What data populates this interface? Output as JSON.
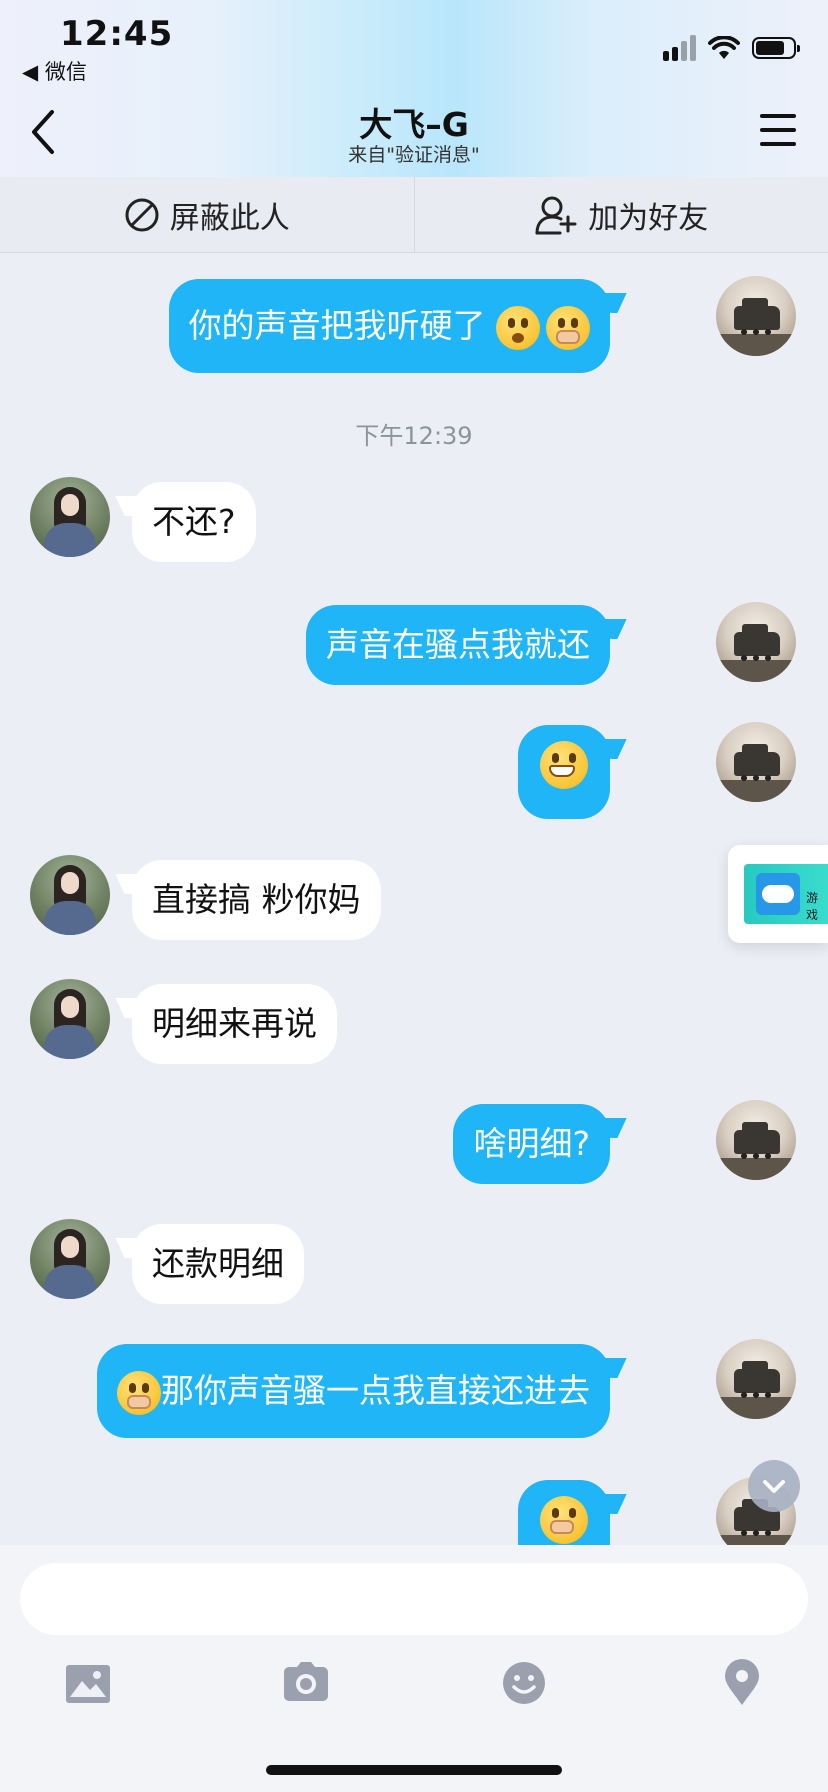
{
  "status_bar": {
    "time": "12:45",
    "back_app": "◀ 微信"
  },
  "header": {
    "title": "大飞–G",
    "subtitle": "来自\"验证消息\""
  },
  "actions": {
    "block": "屏蔽此人",
    "add_friend": "加为好友"
  },
  "messages": [
    {
      "from": "me",
      "text": "你的声音把我听硬了",
      "emojis": [
        "astonished-emoji",
        "hand-over-mouth-emoji"
      ]
    },
    {
      "timestamp": "下午12:39"
    },
    {
      "from": "her",
      "text": "不还?"
    },
    {
      "from": "me",
      "text": "声音在骚点我就还"
    },
    {
      "from": "me",
      "emojis": [
        "grimacing-emoji"
      ]
    },
    {
      "from": "her",
      "text": "直接搞 粆你妈"
    },
    {
      "from": "her",
      "text": "明细来再说"
    },
    {
      "from": "me",
      "text": "啥明细?"
    },
    {
      "from": "her",
      "text": "还款明细"
    },
    {
      "from": "me",
      "text": "那你声音骚一点我直接还进去",
      "emojis": [
        "hand-over-mouth-emoji"
      ]
    },
    {
      "from": "me",
      "emojis": [
        "shushing-emoji"
      ]
    }
  ],
  "game_card": {
    "label": "游戏"
  },
  "input": {
    "placeholder": ""
  },
  "toolbar": [
    "image-icon",
    "camera-icon",
    "emoji-icon",
    "location-icon"
  ],
  "colors": {
    "my_bubble": "#1fb5f7",
    "their_bubble": "#ffffff",
    "background": "#eceef6"
  }
}
